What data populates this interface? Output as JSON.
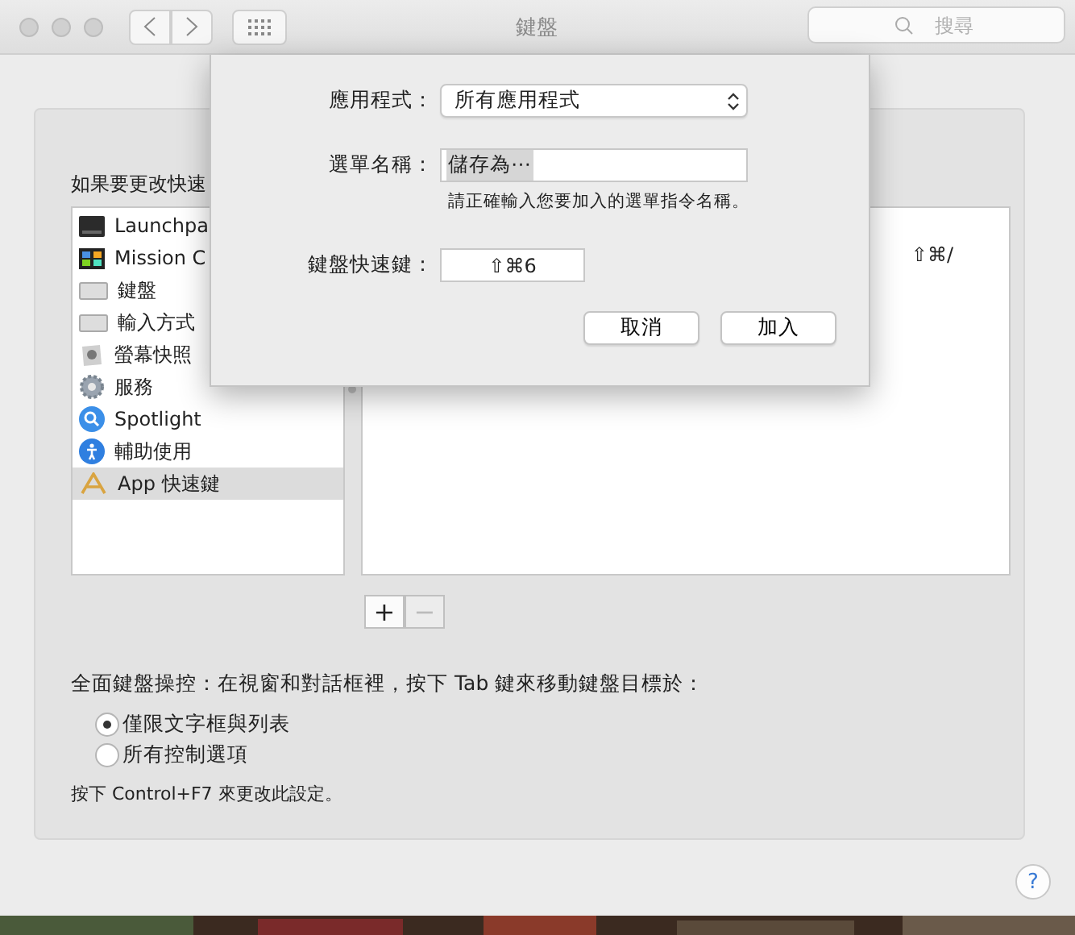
{
  "window": {
    "title": "鍵盤",
    "search": {
      "placeholder": "搜尋"
    }
  },
  "panel": {
    "instruction": "如果要更改快速",
    "categories": [
      {
        "label": "Launchpa",
        "selected": false
      },
      {
        "label": "Mission C",
        "selected": false
      },
      {
        "label": "鍵盤",
        "selected": false
      },
      {
        "label": "輸入方式",
        "selected": false
      },
      {
        "label": "螢幕快照",
        "selected": false
      },
      {
        "label": "服務",
        "selected": false
      },
      {
        "label": "Spotlight",
        "selected": false
      },
      {
        "label": "輔助使用",
        "selected": false
      },
      {
        "label": "App 快速鍵",
        "selected": true
      }
    ],
    "shortcuts": [
      {
        "keys": "⇧⌘/"
      }
    ],
    "add": {
      "label": "+",
      "disabled": false
    },
    "remove": {
      "label": "−",
      "disabled": true
    },
    "full_keyboard_access": {
      "label": "全面鍵盤操控：在視窗和對話框裡，按下 Tab 鍵來移動鍵盤目標於：",
      "options": [
        {
          "label": "僅限文字框與列表",
          "selected": true
        },
        {
          "label": "所有控制選項",
          "selected": false
        }
      ],
      "note": "按下 Control+F7 來更改此設定。"
    }
  },
  "help": "?",
  "dialog": {
    "application": {
      "label": "應用程式：",
      "value": "所有應用程式"
    },
    "menu_title": {
      "label": "選單名稱：",
      "value": "儲存為⋯",
      "text_selected": true
    },
    "hint": "請正確輸入您要加入的選單指令名稱。",
    "shortcut": {
      "label": "鍵盤快速鍵：",
      "value": "⇧⌘6"
    },
    "buttons": [
      "取消",
      "加入"
    ]
  }
}
